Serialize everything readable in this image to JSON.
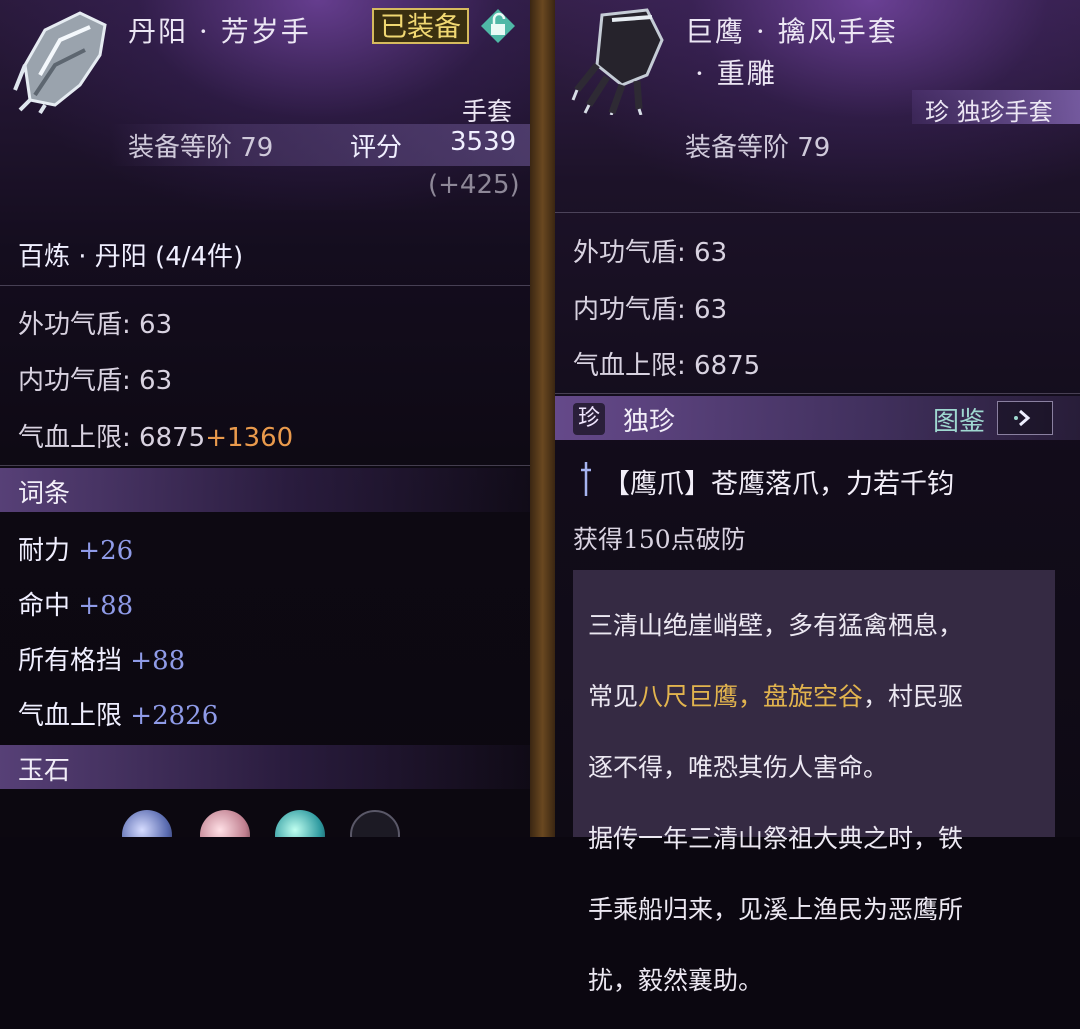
{
  "left": {
    "title": "丹阳 · 芳岁手",
    "equipped_badge": "已装备",
    "slot": "手套",
    "tier": "装备等阶 79",
    "score_label": "评分",
    "score_value": "3539",
    "score_delta": "(+425)",
    "set_name": "百炼 · 丹阳 (4/4件)",
    "stats": [
      {
        "label": "外功气盾: ",
        "value": "63",
        "bonus": ""
      },
      {
        "label": "内功气盾: ",
        "value": "63",
        "bonus": ""
      },
      {
        "label": "气血上限: ",
        "value": "6875",
        "bonus": "+1360"
      }
    ],
    "affix_title": "词条",
    "affixes": [
      {
        "label": "耐力",
        "value": "+26"
      },
      {
        "label": "命中",
        "value": "+88"
      },
      {
        "label": "所有格挡",
        "value": "+88"
      },
      {
        "label": "气血上限",
        "value": "+2826"
      }
    ],
    "jade_title": "玉石"
  },
  "right": {
    "title_line1": "巨鹰 · 擒风手套",
    "title_line2": "· 重雕",
    "rarity_tag": "珍 独珍手套",
    "tier": "装备等阶 79",
    "stats": [
      {
        "label": "外功气盾: ",
        "value": "63"
      },
      {
        "label": "内功气盾: ",
        "value": "63"
      },
      {
        "label": "气血上限: ",
        "value": "6875"
      }
    ],
    "rarity_icon": "珍",
    "rarity_title": "独珍",
    "codex_label": "图鉴",
    "skill_name": "【鹰爪】苍鹰落爪，力若千钧",
    "skill_desc": "获得150点破防",
    "lore": {
      "l1": "三清山绝崖峭壁，多有猛禽栖息，",
      "l2_a": "常见",
      "l2_b": "八尺巨鹰，盘旋空谷",
      "l2_c": "，村民驱",
      "l3": "逐不得，唯恐其伤人害命。",
      "l4": "据传一年三清山祭祖大典之时，铁",
      "l5": "手乘船归来，见溪上渔民为恶鹰所",
      "l6": "扰，毅然襄助。"
    }
  },
  "colors": {
    "affix_blue": "#8f9be8",
    "bonus_orange": "#e99a4c",
    "lore_gold": "#e2b44e",
    "badge_gold": "#d6bb5e"
  }
}
